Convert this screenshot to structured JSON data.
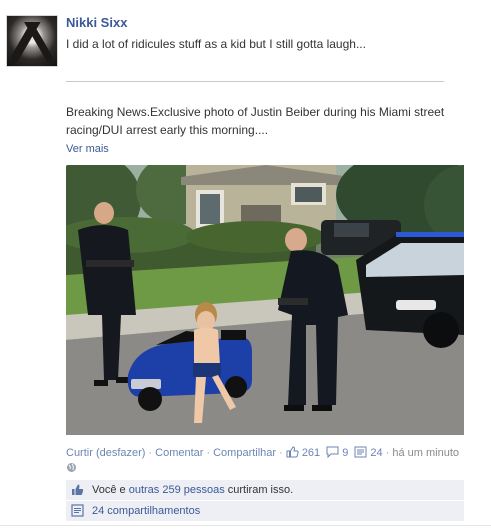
{
  "post": {
    "author": "Nikki Sixx",
    "status_text": "I did a lot of ridicules stuff as a kid but I still gotta laugh...",
    "shared_text": "Breaking News.Exclusive photo of Justin Beiber during his Miami street racing/DUI arrest early this morning....",
    "see_more": "Ver mais"
  },
  "actions": {
    "like": "Curtir (desfazer)",
    "comment": "Comentar",
    "share": "Compartilhar",
    "likes_count": "261",
    "comments_count": "9",
    "shares_count": "24",
    "timestamp": "há um minuto"
  },
  "ufi": {
    "likes_prefix": "Você e ",
    "likes_link": "outras 259 pessoas",
    "likes_suffix": " curtiram isso.",
    "shares": "24 compartilhamentos"
  },
  "colors": {
    "brand": "#3b5998",
    "link": "#6d84b4",
    "ufi_bg": "#edeff4"
  }
}
